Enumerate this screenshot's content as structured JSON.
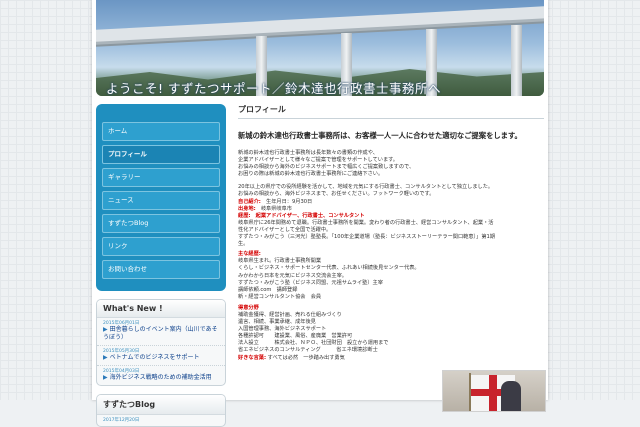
{
  "header": {
    "title": "ようこそ! すずたつサポート／鈴木達也行政書士事務所へ"
  },
  "nav": {
    "items": [
      {
        "label": "ホーム",
        "active": false
      },
      {
        "label": "プロフィール",
        "active": true
      },
      {
        "label": "ギャラリー",
        "active": false
      },
      {
        "label": "ニュース",
        "active": false
      },
      {
        "label": "すずたつBlog",
        "active": false
      },
      {
        "label": "リンク",
        "active": false
      },
      {
        "label": "お問い合わせ",
        "active": false
      }
    ]
  },
  "whats_new": {
    "title": "What's New !",
    "items": [
      {
        "date": "2015年06月01日",
        "text": "田舎暮らしのイベント案内（山川であそうぼう）"
      },
      {
        "date": "2015年05月30日",
        "text": "ベトナムでのビジネスをサポート"
      },
      {
        "date": "2015年04月03日",
        "text": "海外ビジネス戦略のための補助金活用"
      }
    ]
  },
  "blog": {
    "title": "すずたつBlog",
    "date": "2017年12月20日"
  },
  "content": {
    "heading": "プロフィール",
    "lead": "新城の鈴木達也行政書士事務所は、お客様一人一人に合わせた適切なご提案をします。",
    "intro": [
      "新城の鈴木達也行政書士事務所は長年数々の書類の作成や、",
      "企業アドバイザーとして様々なご提案で管理をサポートしています。",
      "お悩みの相談から海外のビジネスサポートまで幅広くご提案致しますので、",
      "お困りの際は新城の鈴木達也行政書士事務所にご連絡下さい。"
    ],
    "experience": [
      "20年以上の県庁での役所経験を活かして、地域を元気にする行政書士、コンサルタントとして独立しました。",
      "お悩みの相談から、海外ビジネスまで、お任せください。フットワーク軽いのです。"
    ],
    "profile": {
      "self_label": "自己紹介:",
      "birth": "生年月日：9月30日",
      "origin_label": "出身地:",
      "origin": "岐阜県岐阜市",
      "career_label": "経歴:",
      "career_red": "起業アドバイザー、行政書士、コンサルタント",
      "career_lines": [
        "岐阜県庁に26年間務めて退職。行政書士事務所を開業。変わり者の行政書士、経営コンサルタント、起業・活",
        "性化アドバイザーとして全国で活躍中。",
        "すずたつ・みがこう（三河光）塾塾長。「100年企業道場（塾長：ビジネスストーリーテラー関口範恵）」第1期",
        "生。"
      ]
    },
    "main_career": {
      "label": "主な経歴:",
      "lines": [
        "岐阜県生まれ。行政書士事務所開業",
        "くらし・ビジネス・サポートセンター代表、ふれあい相続後見センター代表。",
        "みかわから日本を元気にビジネス交流会主宰。",
        "すずたつ・みがこう塾（ビジネス同盟、元祖サムライ塾）主宰",
        "講師依頼.com　講師登録",
        "新・経営コンサルタント協会　会員"
      ]
    },
    "strengths": {
      "label": "得意分野",
      "lines": [
        "補助金獲得、経営計画、売れる仕組みづくり",
        "遺言、相続、事業承継、成年後見",
        "入国管理事務、海外ビジネスサポート",
        "各種許認可　　建設業、風俗、産廃業　営業許可",
        "法人設立　　　株式会社、ＮＰＯ、社団財団　設立から運用まで",
        "省エネビジネスのコンサルティング　　　省エネ環境診断士"
      ]
    },
    "likes": {
      "label": "好きな言葉:",
      "text": "すべては必然　一歩踏み出す勇気"
    }
  }
}
